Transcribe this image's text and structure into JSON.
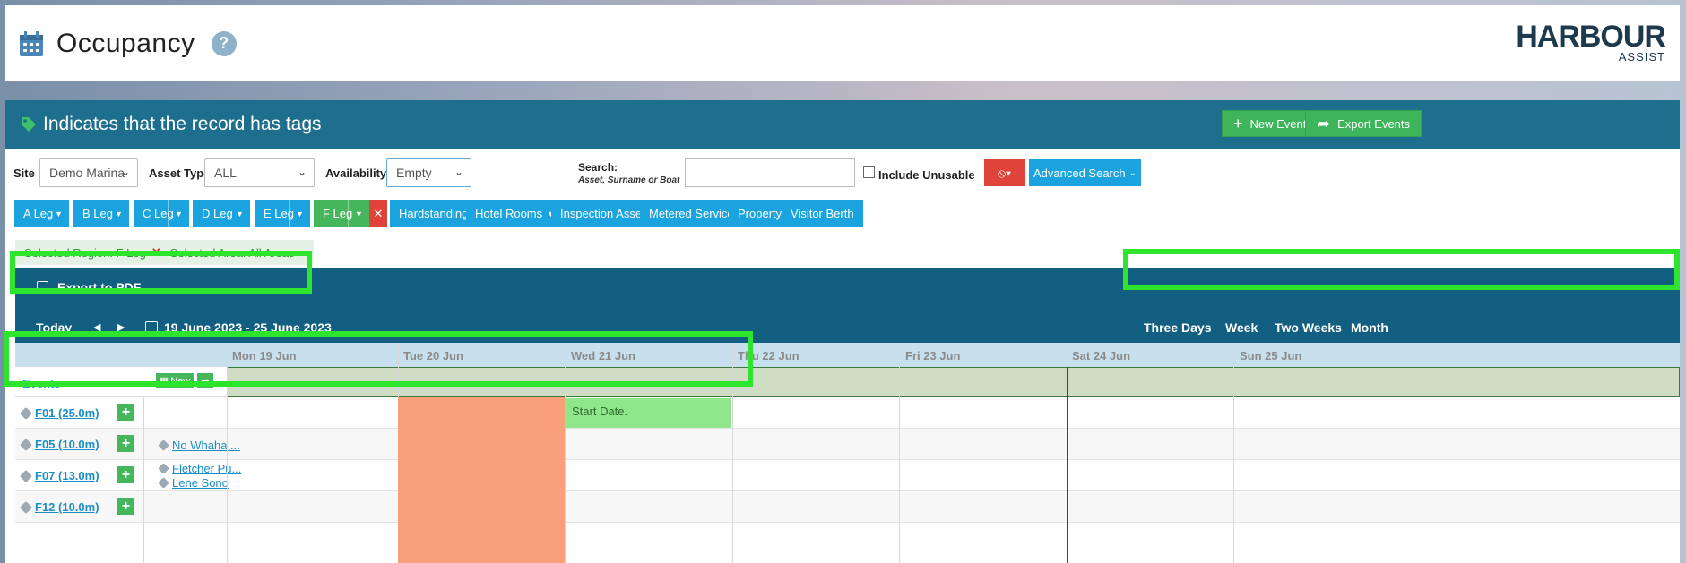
{
  "header": {
    "title": "Occupancy",
    "help": "?",
    "logo_main": "HARBOUR",
    "logo_sub": "ASSIST"
  },
  "panel": {
    "title": "Indicates that the record has tags",
    "new_event": "New Event",
    "export_events": "Export Events"
  },
  "filters": {
    "site_label": "Site",
    "site_value": "Demo Marina",
    "asset_type_label": "Asset Type",
    "asset_type_value": "ALL",
    "availability_label": "Availability:",
    "availability_value": "Empty",
    "search_label": "Search:",
    "search_hint": "Asset, Surname or Boat",
    "search_value": "",
    "include_unusable": "Include Unusable",
    "advanced_search": "Advanced Search"
  },
  "regions": [
    {
      "label": "A Leg"
    },
    {
      "label": "B Leg"
    },
    {
      "label": "C Leg"
    },
    {
      "label": "D Leg"
    },
    {
      "label": "E Leg"
    },
    {
      "label": "F Leg"
    }
  ],
  "areas": [
    "Hardstanding",
    "Hotel Rooms",
    "Inspection Assets",
    "Metered Services",
    "Property",
    "Visitor Berth"
  ],
  "selection": {
    "region": "Selected Region: F Leg",
    "area": "Selected Area: All Areas"
  },
  "calendar": {
    "export_pdf": "Export to PDF",
    "today": "Today",
    "prev": "◀",
    "next": "▶",
    "range": "19 June 2023 - 25 June 2023",
    "views": [
      "Three Days",
      "Week",
      "Two Weeks",
      "Month"
    ],
    "active_view": "Week",
    "days": [
      "Mon 19 Jun",
      "Tue 20 Jun",
      "Wed 21 Jun",
      "Thu 22 Jun",
      "Fri 23 Jun",
      "Sat 24 Jun",
      "Sun 25 Jun"
    ],
    "events_label": "Events",
    "events_new": "New",
    "start_date_text": "Start Date."
  },
  "rows": [
    {
      "asset": "F01 (25.0m)",
      "occupants": []
    },
    {
      "asset": "F05 (10.0m)",
      "occupants": [
        "No Whaha ..."
      ]
    },
    {
      "asset": "F07 (13.0m)",
      "occupants": [
        "Fletcher Pu...",
        "Lene Sono"
      ]
    },
    {
      "asset": "F12 (10.0m)",
      "occupants": []
    }
  ],
  "colors": {
    "header_blue": "#1e6f8e",
    "calendar_blue": "#135f81",
    "accent_green": "#46b65c",
    "button_blue": "#1aa3de",
    "highlight_green": "#2ee52e",
    "booking_orange": "#f9a07a",
    "start_green": "#90e68a"
  }
}
